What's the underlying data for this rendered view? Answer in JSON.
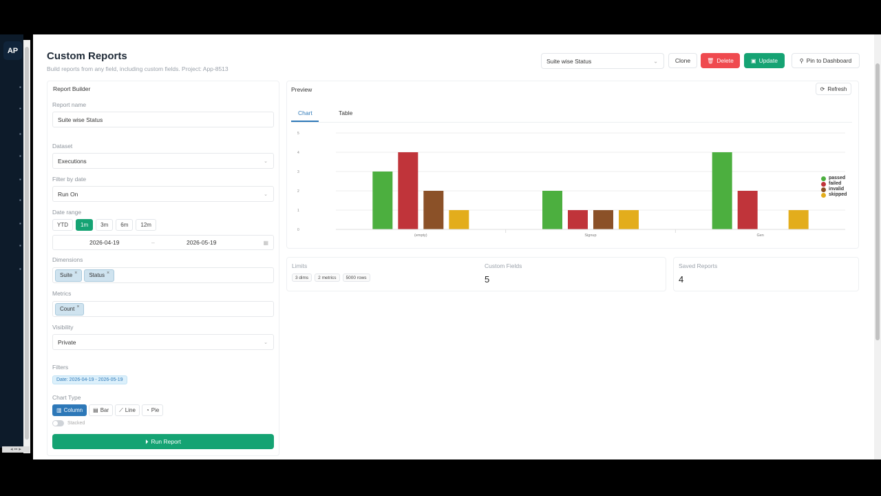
{
  "sidebar": {
    "logo": "AP"
  },
  "header": {
    "title": "Custom Reports",
    "subtitle": "Build reports from any field, including custom fields. Project: App-8513",
    "report_select": "Suite wise Status",
    "clone_label": "Clone",
    "delete_label": "Delete",
    "update_label": "Update",
    "pin_label": "Pin to Dashboard"
  },
  "builder": {
    "heading": "Report Builder",
    "report_name_label": "Report name",
    "report_name_value": "Suite wise Status",
    "dataset_label": "Dataset",
    "dataset_value": "Executions",
    "filter_by_date_label": "Filter by date",
    "filter_by_date_value": "Run On",
    "date_range_label": "Date range",
    "ranges": [
      "YTD",
      "1m",
      "3m",
      "6m",
      "12m"
    ],
    "active_range": "1m",
    "date_from": "2026-04-19",
    "date_to": "2026-05-19",
    "dimensions_label": "Dimensions",
    "dimensions": [
      "Suite",
      "Status"
    ],
    "metrics_label": "Metrics",
    "metrics": [
      "Count"
    ],
    "visibility_label": "Visibility",
    "visibility_value": "Private",
    "filters_label": "Filters",
    "filter_tag": "Date: 2026-04-19 - 2026-05-19",
    "chart_type_label": "Chart Type",
    "chart_types": [
      "Column",
      "Bar",
      "Line",
      "Pie"
    ],
    "active_chart_type": "Column",
    "stacked_label": "Stacked",
    "run_label": "Run Report"
  },
  "preview": {
    "heading": "Preview",
    "refresh_label": "Refresh",
    "tabs": [
      "Chart",
      "Table"
    ],
    "active_tab": "Chart"
  },
  "chart_data": {
    "type": "bar",
    "categories": [
      "(empty)",
      "Signup",
      "Gen"
    ],
    "series": [
      {
        "name": "passed",
        "values": [
          3,
          2,
          4
        ],
        "color": "#4caf3f"
      },
      {
        "name": "failed",
        "values": [
          4,
          1,
          2
        ],
        "color": "#c0343a"
      },
      {
        "name": "invalid",
        "values": [
          2,
          1,
          0
        ],
        "color": "#8b5128"
      },
      {
        "name": "skipped",
        "values": [
          1,
          1,
          1
        ],
        "color": "#e3ad1c"
      }
    ],
    "y_ticks": [
      "0",
      "1",
      "2",
      "3",
      "4",
      "5"
    ],
    "ylim": [
      0,
      5
    ],
    "grid": true,
    "legend": "right"
  },
  "limits": {
    "title": "Limits",
    "pills": [
      "3 dims",
      "2 metrics",
      "5000 rows"
    ]
  },
  "custom_fields": {
    "title": "Custom Fields",
    "value": "5"
  },
  "saved_reports": {
    "title": "Saved Reports",
    "value": "4"
  },
  "colors": {
    "green": "#15a373",
    "red": "#ef4a4f",
    "blue": "#2d78b8",
    "sidebar": "#0d1b2a"
  }
}
